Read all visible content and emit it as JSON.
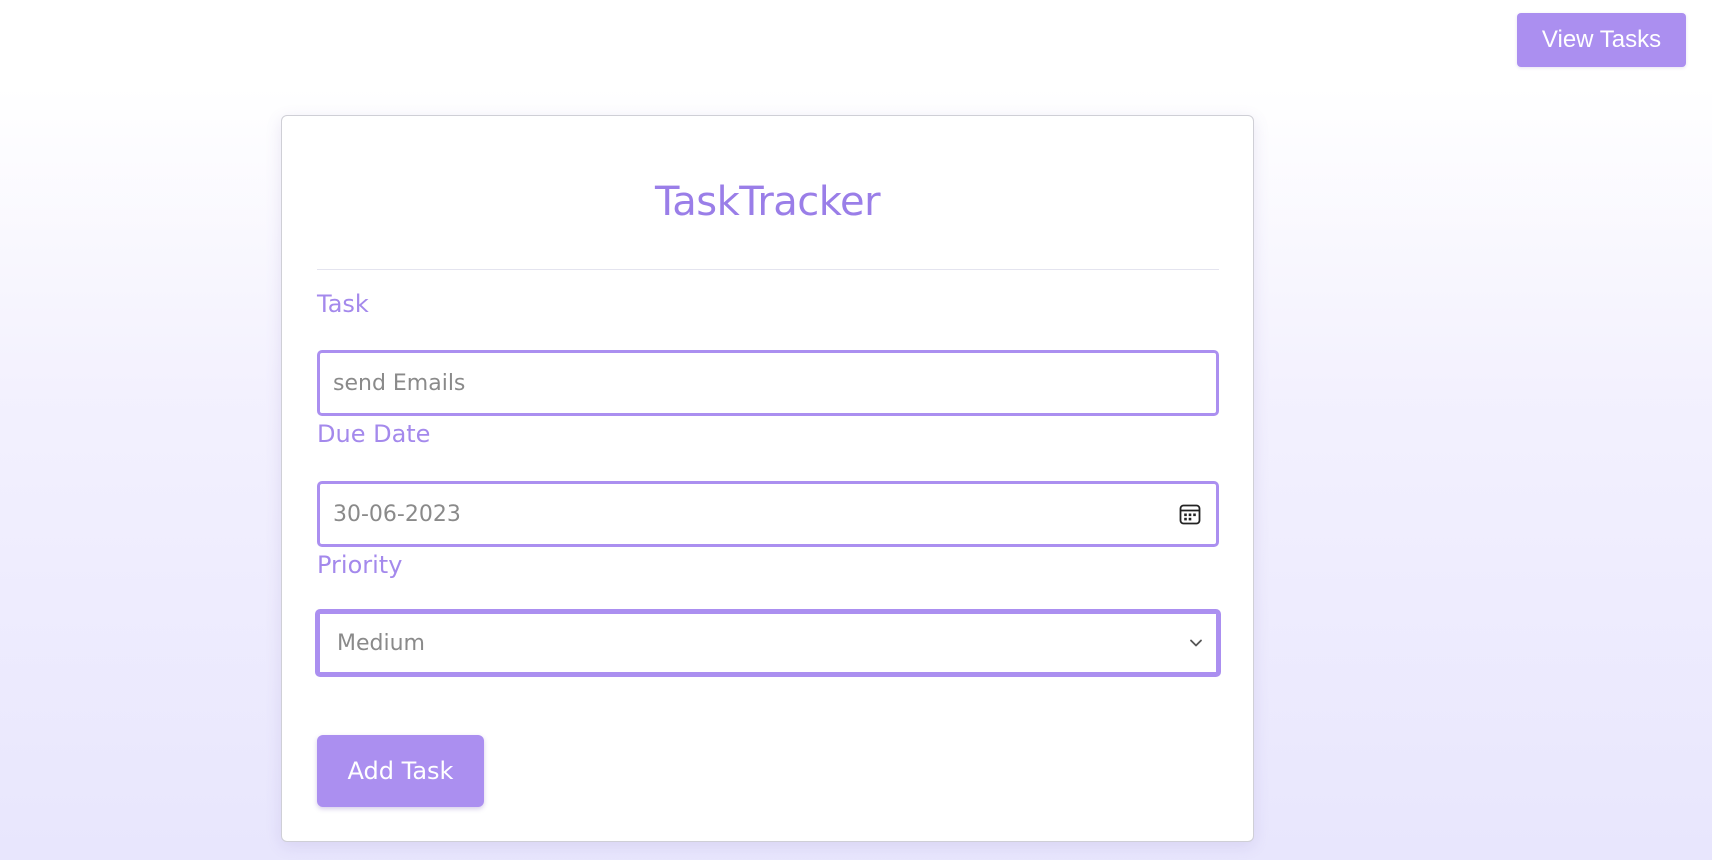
{
  "header": {
    "view_tasks_label": "View Tasks"
  },
  "form": {
    "title": "TaskTracker",
    "task": {
      "label": "Task",
      "value": "send Emails"
    },
    "due_date": {
      "label": "Due Date",
      "value": "30-06-2023",
      "icon": "calendar-icon"
    },
    "priority": {
      "label": "Priority",
      "selected": "Medium",
      "icon": "chevron-down-icon"
    },
    "submit_label": "Add Task"
  },
  "colors": {
    "accent": "#ab8ff0",
    "title": "#9a7ee8",
    "label": "#a489ec",
    "input_text": "#8a8a8a"
  }
}
